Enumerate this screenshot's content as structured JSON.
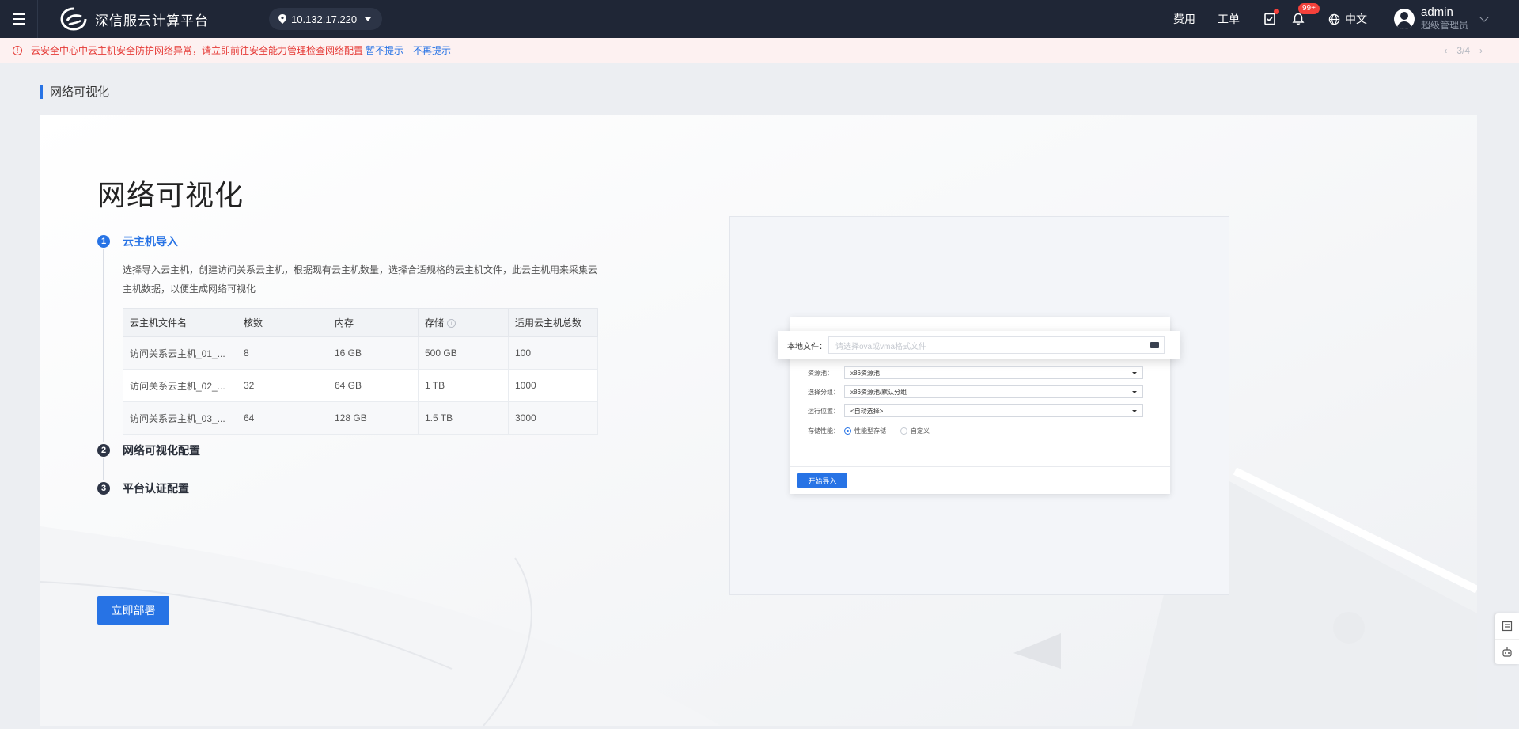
{
  "header": {
    "brand": "深信服云计算平台",
    "ip": "10.132.17.220",
    "links": {
      "fee": "费用",
      "ticket": "工单"
    },
    "notification_badge": "99+",
    "language": "中文",
    "user": {
      "name": "admin",
      "role": "超级管理员"
    }
  },
  "alert": {
    "text": "云安全中心中云主机安全防护网络异常，请立即前往安全能力管理检查网络配置",
    "dismiss_once": "暂不提示",
    "dismiss_forever": "不再提示",
    "pager": "3/4"
  },
  "page": {
    "heading": "网络可视化",
    "title": "网络可视化",
    "deploy_button": "立即部署"
  },
  "steps": [
    {
      "num": "1",
      "title": "云主机导入",
      "description": "选择导入云主机，创建访问关系云主机，根据现有云主机数量，选择合适规格的云主机文件，此云主机用来采集云主机数据，以便生成网络可视化"
    },
    {
      "num": "2",
      "title": "网络可视化配置"
    },
    {
      "num": "3",
      "title": "平台认证配置"
    }
  ],
  "vm_table": {
    "columns": [
      "云主机文件名",
      "核数",
      "内存",
      "存储",
      "适用云主机总数"
    ],
    "rows": [
      [
        "访问关系云主机_01_...",
        "8",
        "16 GB",
        "500 GB",
        "100"
      ],
      [
        "访问关系云主机_02_...",
        "32",
        "64 GB",
        "1 TB",
        "1000"
      ],
      [
        "访问关系云主机_03_...",
        "64",
        "128 GB",
        "1.5 TB",
        "3000"
      ]
    ]
  },
  "preview": {
    "file_label": "本地文件：",
    "file_placeholder": "请选择ova或vma格式文件",
    "rows": [
      {
        "label": "资源池：",
        "value": "x86资源池"
      },
      {
        "label": "选择分组：",
        "value": "x86资源池/默认分组"
      },
      {
        "label": "运行位置：",
        "value": "<自动选择>"
      }
    ],
    "storage_label": "存储性能：",
    "storage_options": [
      "性能型存储",
      "自定义"
    ],
    "start_button": "开始导入"
  },
  "colors": {
    "primary": "#2773e5",
    "topbar": "#1f2636",
    "alert_red": "#e53935"
  }
}
